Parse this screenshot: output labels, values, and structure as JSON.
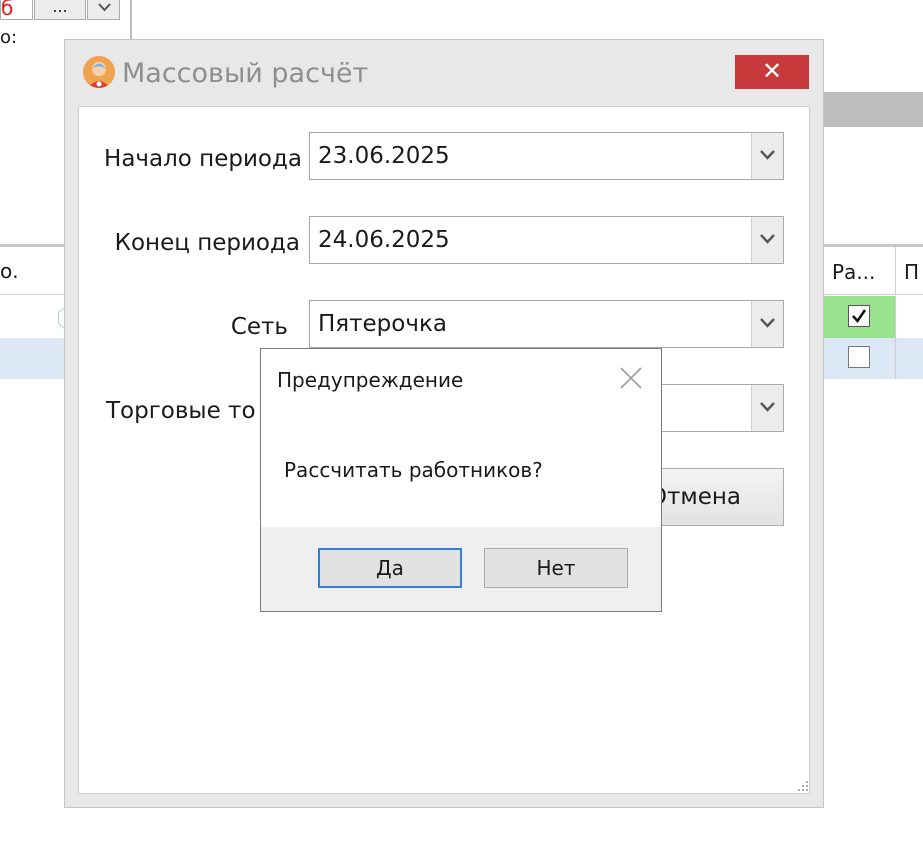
{
  "background": {
    "top_red_text": "б",
    "top_dots_label": "...",
    "top_colon_text": "о:",
    "left_table_header": "о.",
    "right_table_headers": [
      "Ра...",
      "П"
    ],
    "row1_checked": true,
    "row2_checked": false,
    "row1_color": "#99e38e",
    "row2_color": "#dde8f6"
  },
  "dialog": {
    "title": "Массовый расчёт",
    "close_label": "✕",
    "fields": {
      "start_label": "Начало периода",
      "start_value": "23.06.2025",
      "end_label": "Конец периода",
      "end_value": "24.06.2025",
      "network_label": "Сеть",
      "network_value": "Пятерочка",
      "outlets_label": "Торговые то",
      "outlets_value": ""
    },
    "cancel_label": "Отмена",
    "close_button_color": "#c8393b"
  },
  "message_box": {
    "title": "Предупреждение",
    "text": "Рассчитать работников?",
    "yes_label": "Да",
    "no_label": "Нет",
    "focus_color": "#2f7ed8"
  }
}
